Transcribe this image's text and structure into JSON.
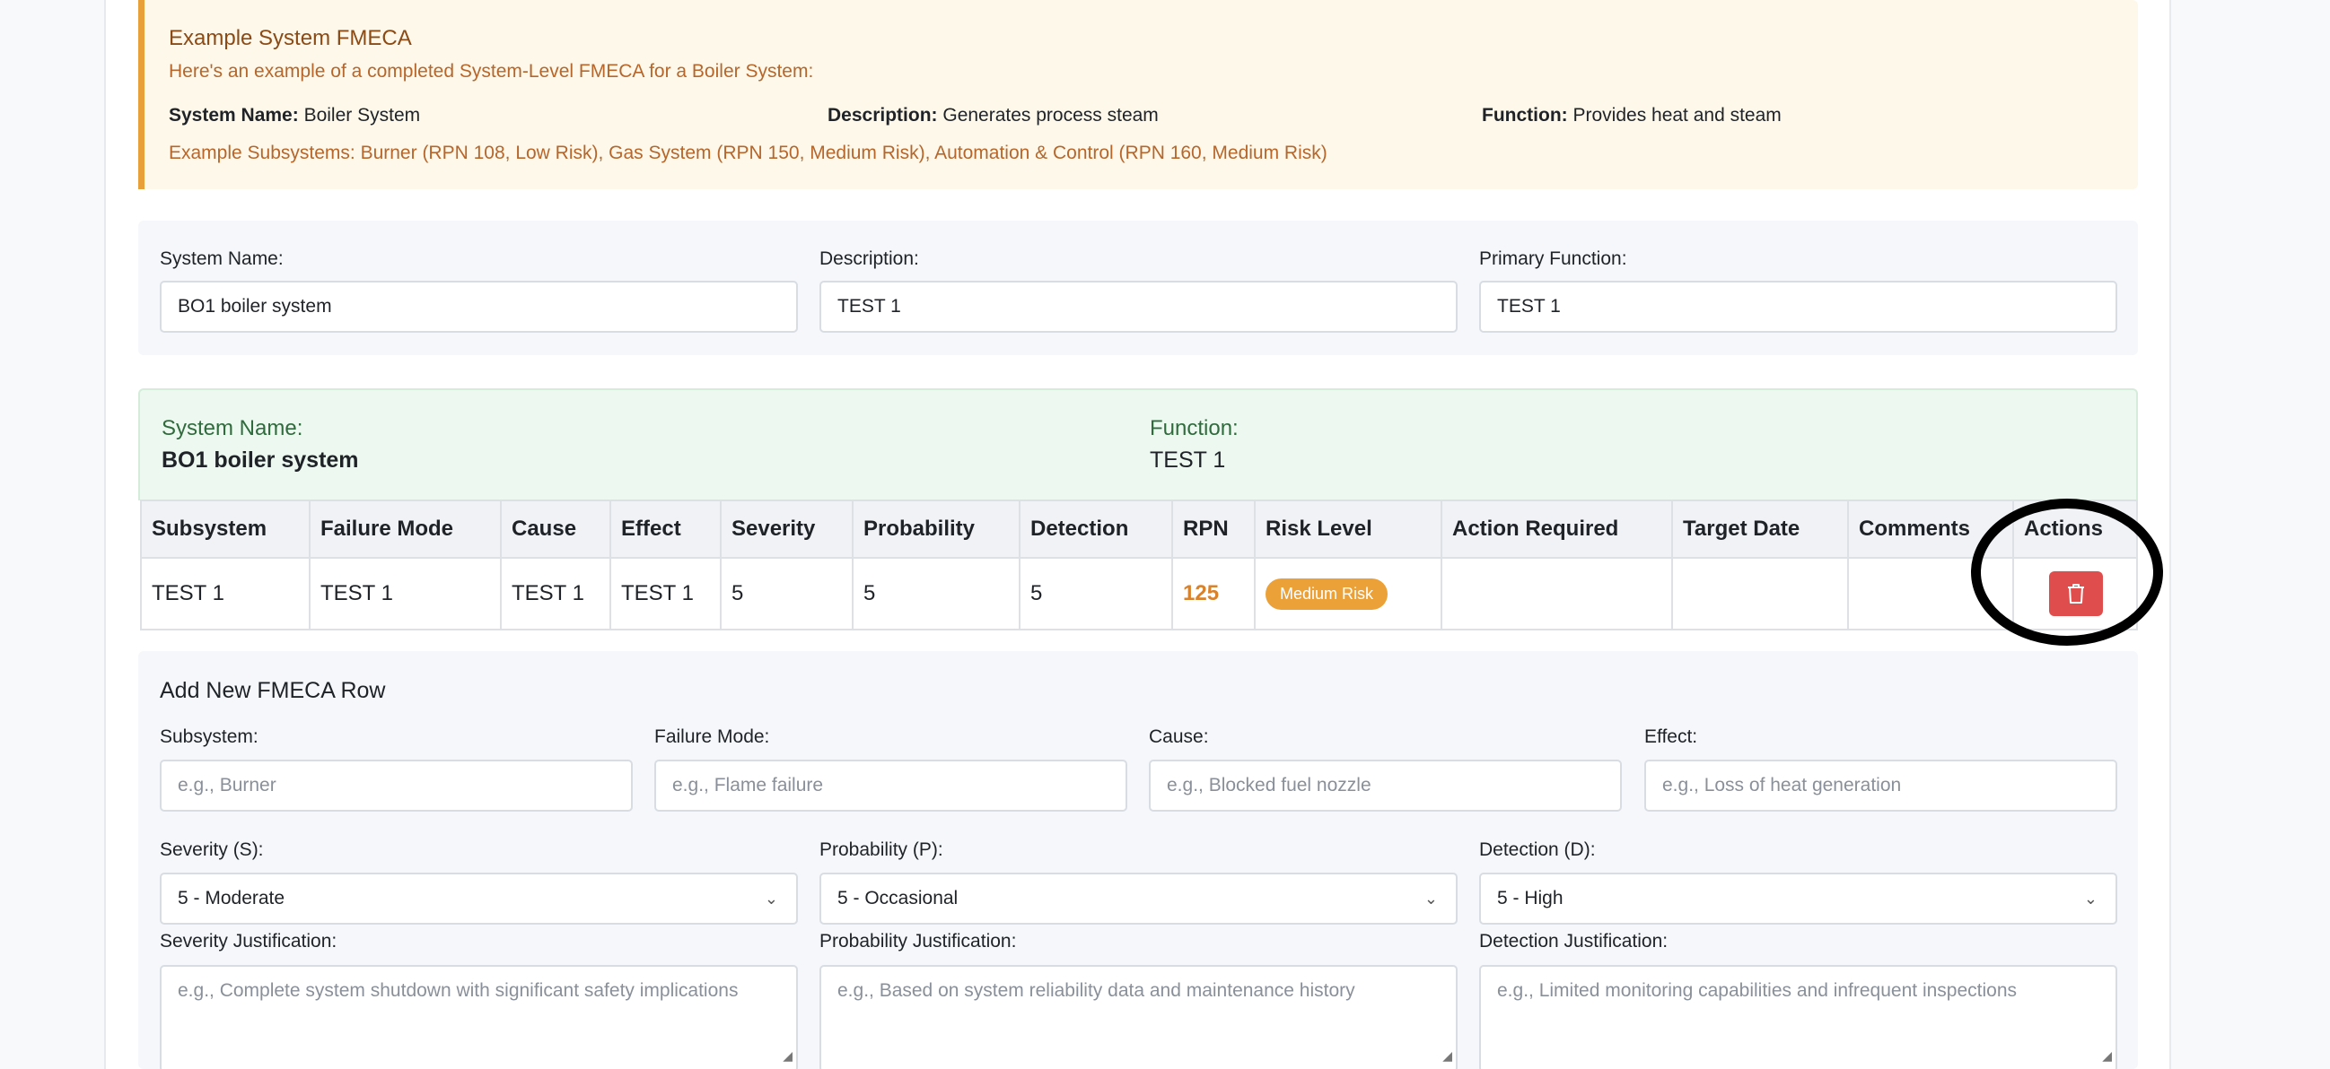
{
  "example": {
    "title": "Example System FMECA",
    "intro": "Here's an example of a completed System-Level FMECA for a Boiler System:",
    "system_name_label": "System Name:",
    "system_name_value": "Boiler System",
    "description_label": "Description:",
    "description_value": "Generates process steam",
    "function_label": "Function:",
    "function_value": "Provides heat and steam",
    "subsystems": "Example Subsystems: Burner (RPN 108, Low Risk), Gas System (RPN 150, Medium Risk), Automation & Control (RPN 160, Medium Risk)"
  },
  "form": {
    "system_name_label": "System Name:",
    "system_name_value": "BO1 boiler system",
    "description_label": "Description:",
    "description_value": "TEST 1",
    "primary_function_label": "Primary Function:",
    "primary_function_value": "TEST 1"
  },
  "summary": {
    "system_name_label": "System Name:",
    "system_name_value": "BO1 boiler system",
    "function_label": "Function:",
    "function_value": "TEST 1"
  },
  "table": {
    "headers": [
      "Subsystem",
      "Failure Mode",
      "Cause",
      "Effect",
      "Severity",
      "Probability",
      "Detection",
      "RPN",
      "Risk Level",
      "Action Required",
      "Target Date",
      "Comments",
      "Actions"
    ],
    "rows": [
      {
        "subsystem": "TEST 1",
        "failure_mode": "TEST 1",
        "cause": "TEST 1",
        "effect": "TEST 1",
        "severity": "5",
        "probability": "5",
        "detection": "5",
        "rpn": "125",
        "risk_level": "Medium Risk",
        "action_required": "",
        "target_date": "",
        "comments": ""
      }
    ]
  },
  "add_row": {
    "title": "Add New FMECA Row",
    "subsystem_label": "Subsystem:",
    "subsystem_placeholder": "e.g., Burner",
    "failure_mode_label": "Failure Mode:",
    "failure_mode_placeholder": "e.g., Flame failure",
    "cause_label": "Cause:",
    "cause_placeholder": "e.g., Blocked fuel nozzle",
    "effect_label": "Effect:",
    "effect_placeholder": "e.g., Loss of heat generation",
    "severity_label": "Severity (S):",
    "severity_value": "5 - Moderate",
    "probability_label": "Probability (P):",
    "probability_value": "5 - Occasional",
    "detection_label": "Detection (D):",
    "detection_value": "5 - High",
    "severity_just_label": "Severity Justification:",
    "severity_just_placeholder": "e.g., Complete system shutdown with significant safety implications",
    "probability_just_label": "Probability Justification:",
    "probability_just_placeholder": "e.g., Based on system reliability data and maintenance history",
    "detection_just_label": "Detection Justification:",
    "detection_just_placeholder": "e.g., Limited monitoring capabilities and infrequent inspections"
  },
  "colors": {
    "accent_orange": "#e8a13a",
    "risk_medium": "#eba137",
    "delete_red": "#e04d4d",
    "summary_green": "#edf9f0"
  }
}
